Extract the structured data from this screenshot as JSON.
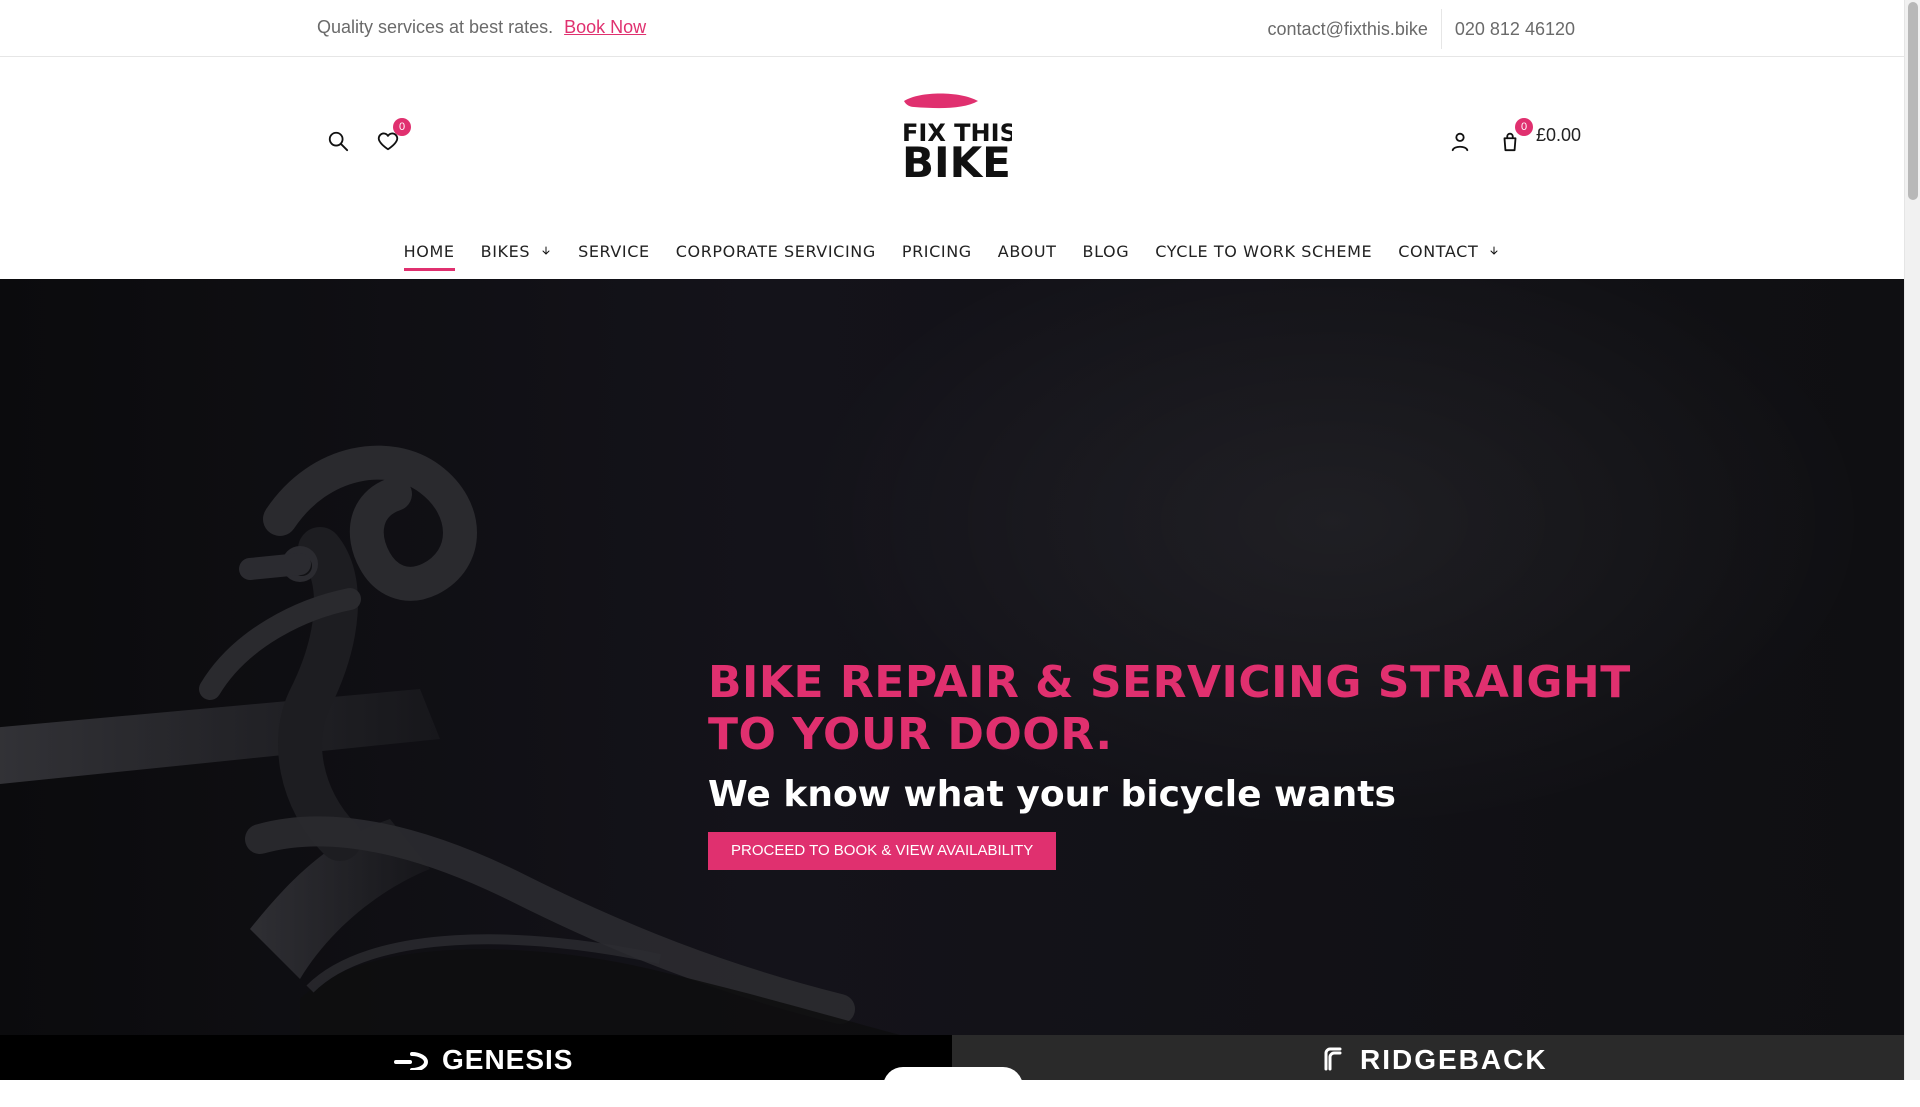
{
  "topbar": {
    "left_text": "Quality services at best rates.",
    "cta_link": "Book Now",
    "email": "contact@fixthis.bike",
    "phone": "020 812 46120"
  },
  "header": {
    "icons": {
      "search": "search-icon",
      "wishlist": "heart-icon",
      "account": "user-icon",
      "cart": "bag-icon"
    },
    "wishlist_count": "0",
    "cart_count": "0",
    "cart_amount": "£0.00",
    "logo_text_1": "FIX THIS",
    "logo_text_2": "BIKE"
  },
  "nav": {
    "items": [
      {
        "label": "HOME",
        "active": true,
        "has_dropdown": false
      },
      {
        "label": "BIKES",
        "active": false,
        "has_dropdown": true
      },
      {
        "label": "SERVICE",
        "active": false,
        "has_dropdown": false
      },
      {
        "label": "CORPORATE SERVICING",
        "active": false,
        "has_dropdown": false
      },
      {
        "label": "PRICING",
        "active": false,
        "has_dropdown": false
      },
      {
        "label": "ABOUT",
        "active": false,
        "has_dropdown": false
      },
      {
        "label": "BLOG",
        "active": false,
        "has_dropdown": false
      },
      {
        "label": "CYCLE TO WORK SCHEME",
        "active": false,
        "has_dropdown": false
      },
      {
        "label": "CONTACT",
        "active": false,
        "has_dropdown": true
      }
    ]
  },
  "hero": {
    "title": "BIKE REPAIR & SERVICING STRAIGHT TO YOUR DOOR.",
    "subtitle": "We know what your bicycle wants",
    "cta": "PROCEED TO BOOK & VIEW AVAILABILITY"
  },
  "brands": {
    "left": "GENESIS",
    "right": "RIDGEBACK"
  },
  "colors": {
    "accent": "#e0306f",
    "hero_bg": "#141319",
    "topbar_text": "#6a6a6a"
  }
}
